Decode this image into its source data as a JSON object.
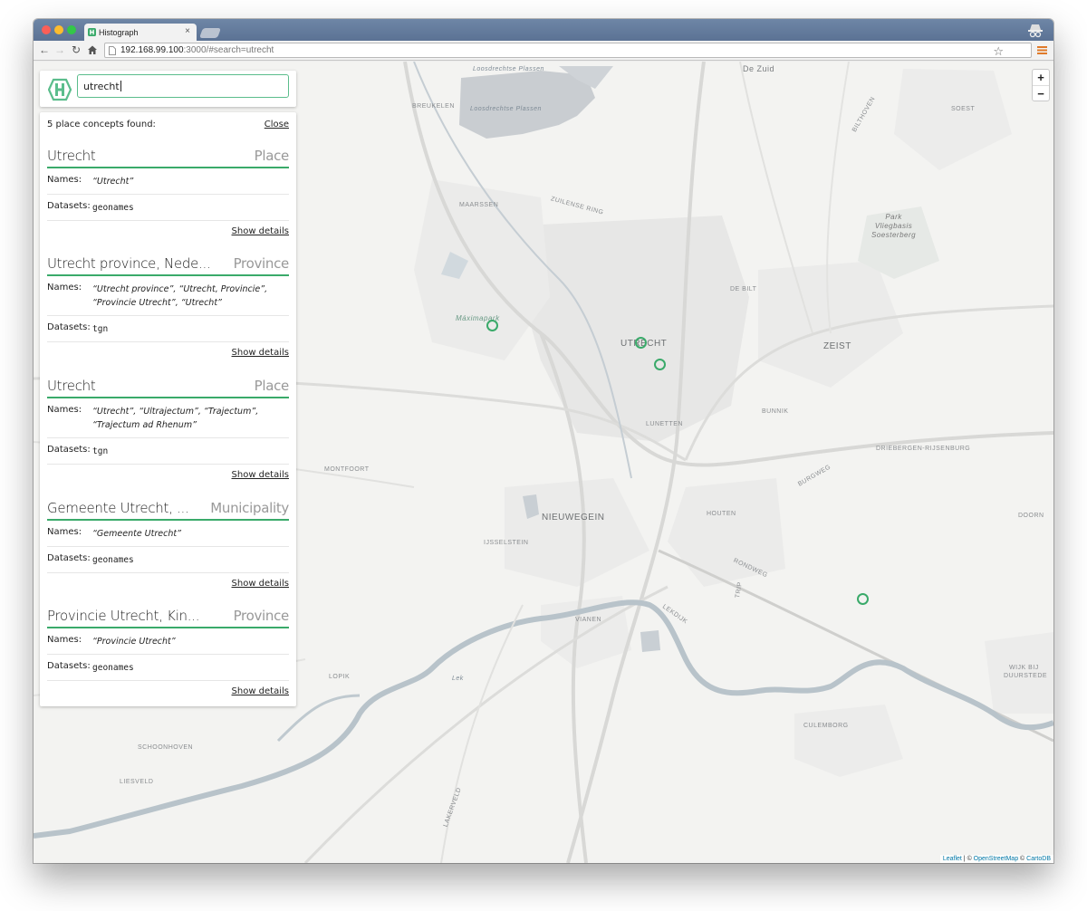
{
  "browser": {
    "tab_title": "Histograph",
    "tab_close": "×",
    "url_host": "192.168.99.100",
    "url_rest": ":3000/#search=utrecht",
    "star": "☆"
  },
  "search": {
    "value": "utrecht"
  },
  "results_panel": {
    "summary": "5 place concepts found:",
    "close_label": "Close",
    "names_label": "Names:",
    "datasets_label": "Datasets:",
    "details_label": "Show details",
    "items": [
      {
        "name": "Utrecht",
        "type": "Place",
        "names": "“Utrecht”",
        "dataset": "geonames"
      },
      {
        "name": "Utrecht province, Nede...",
        "type": "Province",
        "names": "“Utrecht province”, “Utrecht, Provincie”, “Provincie Utrecht”, “Utrecht”",
        "dataset": "tgn"
      },
      {
        "name": "Utrecht",
        "type": "Place",
        "names": "“Utrecht”, “Ultrajectum”, “Trajectum”, “Trajectum ad Rhenum”",
        "dataset": "tgn"
      },
      {
        "name": "Gemeente Utrecht, ...",
        "type": "Municipality",
        "names": "“Gemeente Utrecht”",
        "dataset": "geonames"
      },
      {
        "name": "Provincie Utrecht, Kin...",
        "type": "Province",
        "names": "“Provincie Utrecht”",
        "dataset": "geonames"
      }
    ]
  },
  "map": {
    "zoom_in": "+",
    "zoom_out": "−",
    "attribution": {
      "leaflet": "Leaflet",
      "sep1": " | © ",
      "osm": "OpenStreetMap",
      "sep2": " © ",
      "carto": "CartoDB"
    },
    "labels": {
      "de_zuid": "De Zuid",
      "loosdrecht1": "Loosdrechtse Plassen",
      "loosdrecht2": "Loosdrechtse Plassen",
      "breukelen": "BREUKELEN",
      "maarssen": "MAARSSEN",
      "zuilense": "ZUILENSE RING",
      "bilthoven": "BILTHOVEN",
      "soest": "SOEST",
      "de_bilt": "DE BILT",
      "zeist": "ZEIST",
      "utrecht": "UTRECHT",
      "maximapark": "Máximapark",
      "bunnik": "BUNNIK",
      "lunetten": "LUNETTEN",
      "driebergen": "DRIEBERGEN-RIJSENBURG",
      "montfoort": "MONTFOORT",
      "nieuwegein": "NIEUWEGEIN",
      "houten": "HOUTEN",
      "ijsselstein": "IJSSELSTEIN",
      "doorn": "DOORN",
      "vianen": "VIANEN",
      "lekdijk": "LEKDIJK",
      "rondweg": "RONDWEG",
      "burgweg": "BURGWEG",
      "trip": "TRIP",
      "lopik": "LOPIK",
      "lek": "Lek",
      "culemborg": "CULEMBORG",
      "wijk": "WIJK BIJ",
      "duurstede": "DUURSTEDE",
      "schoonhoven": "SCHOONHOVEN",
      "liesveld": "LIESVELD",
      "lakerveld": "LAKERVELD",
      "park_line1": "Park",
      "park_line2": "Vliegbasis",
      "park_line3": "Soesterberg"
    }
  }
}
